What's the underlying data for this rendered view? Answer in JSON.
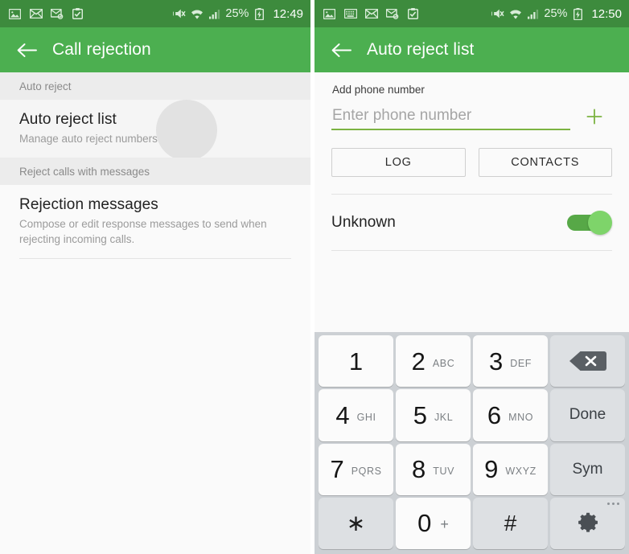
{
  "theme": {
    "status_bar_green": "#3d8b3d",
    "app_bar_green": "#4caf50",
    "accent_green": "#7cb342",
    "toggle_track": "#57a847",
    "toggle_thumb": "#7ed46a",
    "keypad_bg": "#ccd0d4"
  },
  "left": {
    "status": {
      "icons": [
        "picture-icon",
        "envelope-icon",
        "envelope-sync-icon",
        "clipboard-check-icon"
      ],
      "right_icons": [
        "mute-icon",
        "wifi-icon",
        "signal-icon",
        "battery-charging-icon"
      ],
      "battery": "25%",
      "time": "12:49"
    },
    "appbar": {
      "back": "back-arrow-icon",
      "title": "Call rejection"
    },
    "sections": [
      {
        "header": "Auto reject",
        "items": [
          {
            "title": "Auto reject list",
            "subtitle": "Manage auto reject numbers."
          }
        ]
      },
      {
        "header": "Reject calls with messages",
        "items": [
          {
            "title": "Rejection messages",
            "subtitle": "Compose or edit response messages to send when rejecting incoming calls."
          }
        ]
      }
    ]
  },
  "right": {
    "status": {
      "icons": [
        "picture-icon",
        "keyboard-icon",
        "envelope-icon",
        "envelope-sync-icon",
        "clipboard-check-icon"
      ],
      "right_icons": [
        "mute-icon",
        "wifi-icon",
        "signal-icon",
        "battery-charging-icon"
      ],
      "battery": "25%",
      "time": "12:50"
    },
    "appbar": {
      "back": "back-arrow-icon",
      "title": "Auto reject list"
    },
    "form": {
      "label": "Add phone number",
      "input_value": "",
      "input_placeholder": "Enter phone number",
      "add_icon": "plus-icon",
      "buttons": {
        "log": "LOG",
        "contacts": "CONTACTS"
      }
    },
    "toggle": {
      "label": "Unknown",
      "state": "on"
    },
    "keypad": {
      "rows": [
        [
          {
            "type": "num",
            "digit": "1",
            "letters": ""
          },
          {
            "type": "num",
            "digit": "2",
            "letters": "ABC"
          },
          {
            "type": "num",
            "digit": "3",
            "letters": "DEF"
          },
          {
            "type": "func",
            "icon": "backspace-icon",
            "label": ""
          }
        ],
        [
          {
            "type": "num",
            "digit": "4",
            "letters": "GHI"
          },
          {
            "type": "num",
            "digit": "5",
            "letters": "JKL"
          },
          {
            "type": "num",
            "digit": "6",
            "letters": "MNO"
          },
          {
            "type": "func",
            "icon": "",
            "label": "Done"
          }
        ],
        [
          {
            "type": "num",
            "digit": "7",
            "letters": "PQRS"
          },
          {
            "type": "num",
            "digit": "8",
            "letters": "TUV"
          },
          {
            "type": "num",
            "digit": "9",
            "letters": "WXYZ"
          },
          {
            "type": "func",
            "icon": "",
            "label": "Sym"
          }
        ],
        [
          {
            "type": "func",
            "digit": "∗",
            "letters": ""
          },
          {
            "type": "num",
            "digit": "0",
            "letters": "+"
          },
          {
            "type": "func",
            "digit": "#",
            "letters": ""
          },
          {
            "type": "func",
            "icon": "gear-icon",
            "label": ""
          }
        ]
      ]
    }
  }
}
